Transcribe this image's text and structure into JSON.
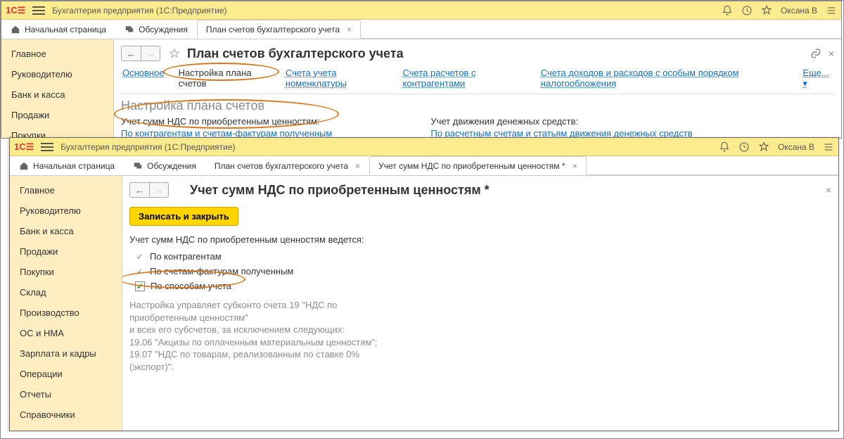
{
  "win1": {
    "app": "Бухгалтерия предприятия  (1С:Предприятие)",
    "user": "Оксана В",
    "tabs": {
      "home": "Начальная страница",
      "chat": "Обсуждения",
      "plan": "План счетов бухгалтерского учета"
    },
    "sidebar": [
      "Главное",
      "Руководителю",
      "Банк и касса",
      "Продажи",
      "Покупки"
    ],
    "title": "План счетов бухгалтерского учета",
    "subtabs": {
      "main": "Основное",
      "setup": "Настройка плана счетов",
      "nom": "Счета учета номенклатуры",
      "contr": "Счета расчетов с контрагентами",
      "tax": "Счета доходов и расходов с особым порядком налогообложения",
      "more": "Еще..."
    },
    "h2": "Настройка плана счетов",
    "left": {
      "label": "Учет сумм НДС по приобретенным ценностям:",
      "link": "По контрагентам и счетам-фактурам полученным"
    },
    "right": {
      "label": "Учет движения денежных средств:",
      "link": "По расчетным счетам и статьям движения денежных средств"
    }
  },
  "win2": {
    "app": "Бухгалтерия предприятия  (1С:Предприятие)",
    "user": "Оксана В",
    "tabs": {
      "home": "Начальная страница",
      "chat": "Обсуждения",
      "plan": "План счетов бухгалтерского учета",
      "nds": "Учет сумм НДС по приобретенным ценностям *"
    },
    "sidebar": [
      "Главное",
      "Руководителю",
      "Банк и касса",
      "Продажи",
      "Покупки",
      "Склад",
      "Производство",
      "ОС и НМА",
      "Зарплата и кадры",
      "Операции",
      "Отчеты",
      "Справочники"
    ],
    "title": "Учет сумм НДС по приобретенным ценностям *",
    "save": "Записать и закрыть",
    "formlabel": "Учет сумм НДС по приобретенным ценностям ведется:",
    "opt1": "По контрагентам",
    "opt2": "По счетам-фактурам полученным",
    "opt3": "По способам учета",
    "grey": "Настройка управляет субконто счета 19 \"НДС по приобретенным ценностям\"\nи всех его субсчетов, за исключением следующих:\n19.06 \"Акцизы по оплаченным материальным ценностям\";\n19.07 \"НДС по товарам, реализованным по ставке 0% (экспорт)\"."
  }
}
